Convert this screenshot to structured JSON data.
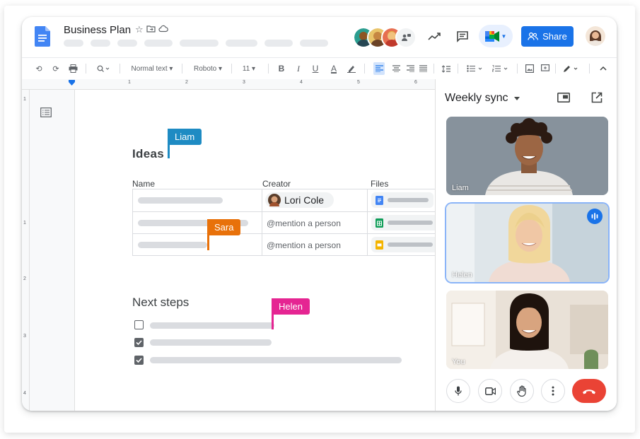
{
  "doc": {
    "title": "Business Plan",
    "share_label": "Share"
  },
  "toolbar": {
    "style": "Normal text",
    "font": "Roboto",
    "size": "11"
  },
  "ruler": {
    "marks": [
      "1",
      "2",
      "3",
      "4",
      "5",
      "6"
    ],
    "vmarks": [
      "1",
      "1",
      "2",
      "3",
      "4"
    ]
  },
  "content": {
    "ideas_heading": "Ideas",
    "table_headers": [
      "Name",
      "Creator",
      "Files"
    ],
    "creator_chip": "Lori Cole",
    "mention_placeholder": "@mention a person",
    "next_steps_heading": "Next steps"
  },
  "cursors": {
    "liam": {
      "label": "Liam",
      "color": "#1e8bc3"
    },
    "sara": {
      "label": "Sara",
      "color": "#e8710a"
    },
    "helen": {
      "label": "Helen",
      "color": "#e52592"
    }
  },
  "meet": {
    "title": "Weekly sync",
    "participants": [
      "Liam",
      "Helen",
      "You"
    ]
  },
  "colors": {
    "accent": "#1a73e8",
    "end_call": "#ea4335"
  }
}
